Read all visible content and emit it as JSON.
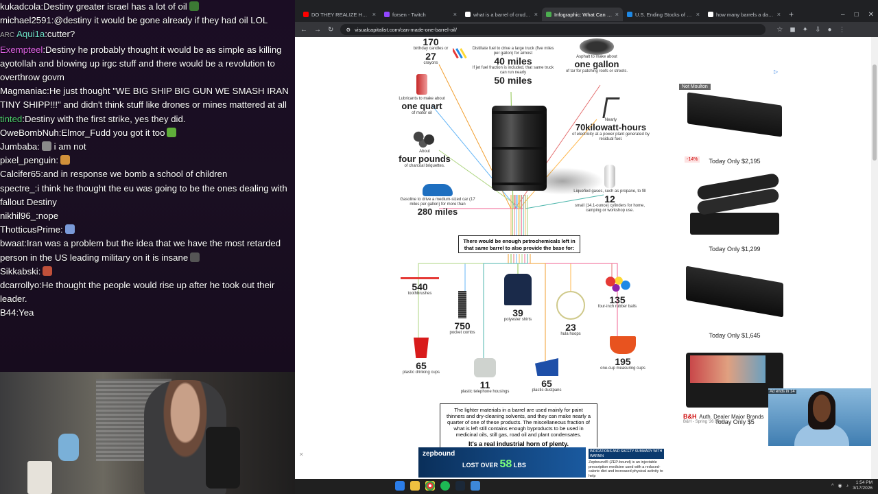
{
  "chat": {
    "messages": [
      {
        "user": "kukadcola",
        "text": "Destiny greater israel has a lot of oil",
        "color": "#ffffff",
        "emote": "#3c7a34"
      },
      {
        "user": "michael2591",
        "text": "@destiny it would be gone already if they had oil LOL",
        "color": "#ffffff"
      },
      {
        "user": "Aqui1a",
        "text": "cutter?",
        "color": "#6ee0c8",
        "badge": "ARC"
      },
      {
        "user": "Exempteel",
        "text": "Destiny he probably thought it would be as simple as killing ayotollah and blowing up irgc stuff and there would be a revolution to overthrow govm",
        "color": "#e063e6"
      },
      {
        "user": "Magmaniac",
        "text": "He just thought \"WE BIG SHIP BIG GUN WE SMASH IRAN TINY SHIPP!!!\" and didn't think stuff like drones or mines mattered at all",
        "color": "#ffffff"
      },
      {
        "user": "tinted",
        "text": "Destiny with the first strike, yes they did.",
        "color": "#4cd06a"
      },
      {
        "user": "OweBombNuh",
        "text": "Elmor_Fudd you got it too",
        "color": "#ffffff",
        "emote": "#5fae3a"
      },
      {
        "user": "Jumbaba",
        "text": "i am not",
        "color": "#ffffff",
        "emote_before": "#8a8a8a"
      },
      {
        "user": "pixel_penguin",
        "text": "",
        "color": "#ffffff",
        "emote": "#d0903a"
      },
      {
        "user": "Calcifer65",
        "text": "and in response we bomb a school of children",
        "color": "#ffffff"
      },
      {
        "user": "spectre_",
        "text": "i think he thought the eu was going to be the ones dealing with fallout  Destiny",
        "color": "#ffffff"
      },
      {
        "user": "nikhil96_",
        "text": "nope",
        "color": "#ffffff"
      },
      {
        "user": "ThotticusPrime",
        "text": "",
        "color": "#ffffff",
        "emote": "#7a9ad8"
      },
      {
        "user": "bwaat",
        "text": "Iran was a problem but the idea that we have the most retarded person in the US leading military on it is insane",
        "color": "#ffffff",
        "emote": "#555555"
      },
      {
        "user": "Sikkabski",
        "text": "",
        "color": "#ffffff",
        "emote": "#c0503a"
      },
      {
        "user": "dcarrollyo",
        "text": "He thought the people would rise up after he took out their leader.",
        "color": "#ffffff"
      },
      {
        "user": "B44",
        "text": "Yea",
        "color": "#ffffff"
      }
    ]
  },
  "browser": {
    "tabs": [
      {
        "title": "DO THEY REALIZE HOW DESPE",
        "fav": "#ff0000",
        "active": false
      },
      {
        "title": "forsen - Twitch",
        "fav": "#9146ff",
        "active": false
      },
      {
        "title": "what is a barrel of crude oil - G",
        "fav": "#ffffff",
        "active": false
      },
      {
        "title": "Infographic: What Can Be Made",
        "fav": "#4caf50",
        "active": true
      },
      {
        "title": "U.S. Ending Stocks of Crude O",
        "fav": "#1e88e5",
        "active": false
      },
      {
        "title": "how many barrels a day does u",
        "fav": "#ffffff",
        "active": false
      }
    ],
    "new_tab": "+",
    "url": "visualcapitalist.com/can-made-one-barrel-oil/",
    "window_controls": [
      "–",
      "□",
      "✕"
    ]
  },
  "infographic": {
    "items": [
      {
        "num": "170",
        "desc_top": "birthday candles or",
        "desc": "27",
        "desc2": "crayons"
      },
      {
        "num": "40 miles",
        "desc_top": "Distillate fuel to drive a large truck (five miles per gallon) for almost",
        "desc2": "If jet fuel fraction is included, that same truck can run nearly",
        "num2": "50 miles"
      },
      {
        "num": "one gallon",
        "desc_top": "Asphalt to make about",
        "desc2": "of tar for patching roofs or streets."
      },
      {
        "num": "one quart",
        "desc_top": "Lubricants to make about",
        "desc2": "of motor oil"
      },
      {
        "num": "70kilowatt-hours",
        "desc_top": "Nearly",
        "desc2": "of electricity at a power plant generated by residual fuel."
      },
      {
        "num": "four pounds",
        "desc_top": "About",
        "desc2": "of charcoal briquettes."
      },
      {
        "num": "280 miles",
        "desc_top": "Gasoline to drive a medium-sized car (17 miles per gallon) for more than"
      },
      {
        "num": "12",
        "desc_top": "Liquefied gases, such as propane, to fill",
        "desc2": "small (14.1-ounce) cylinders for home, camping or workshop use."
      },
      {
        "num": "540",
        "desc2": "toothbrushes"
      },
      {
        "num": "39",
        "desc2": "polyester shirts"
      },
      {
        "num": "135",
        "desc2": "four-inch rubber balls"
      },
      {
        "num": "750",
        "desc2": "pocket combs"
      },
      {
        "num": "23",
        "desc2": "hula hoops"
      },
      {
        "num": "65",
        "desc2": "plastic drinking cups"
      },
      {
        "num": "195",
        "desc2": "one-cup measuring cups"
      },
      {
        "num": "11",
        "desc2": "plastic telephone housings"
      },
      {
        "num": "65",
        "desc2": "plastic dustpans"
      }
    ],
    "center_box": "There would be enough petrochemicals left in that same barrel to also provide the base for:",
    "foot_box": "The lighter materials in a barrel are used mainly for paint thinners and dry-cleaning solvents, and they can make nearly a quarter of one of these products. The miscellaneous fraction of what is left still contains enough byproducts to be used in medicinal oils, still gas, road oil and plant condensates.",
    "foot_tagline": "It's a real industrial horn of plenty."
  },
  "ads": {
    "products": [
      {
        "price": "Today Only $2,195"
      },
      {
        "price": "Today Only $1,299",
        "badge": "-14%"
      },
      {
        "price": "Today Only $1,645"
      },
      {
        "price": "Today Only $5"
      }
    ],
    "bh_logo": "B&H",
    "bh_title": "Auth. Dealer Major Brands",
    "bh_sub": "B&H - Spring '26 Deals",
    "overlay_name": "Not Moulton",
    "video_label": "Ad ends in 14",
    "adchoices": "▷"
  },
  "banner": {
    "brand": "zepbound",
    "lost": "LOST OVER",
    "lbs": "58",
    "lbs_unit": "LBS",
    "right_header": "INDICATIONS AND SAFETY SUMMARY WITH WARNIN",
    "right_text": "Zepbound® (ZEP-bound) is an injectable prescription medicine used with a reduced-calorie diet and increased physical activity to help",
    "close": "✕"
  },
  "taskbar": {
    "time": "1:54 PM",
    "date": "3/17/2026"
  }
}
